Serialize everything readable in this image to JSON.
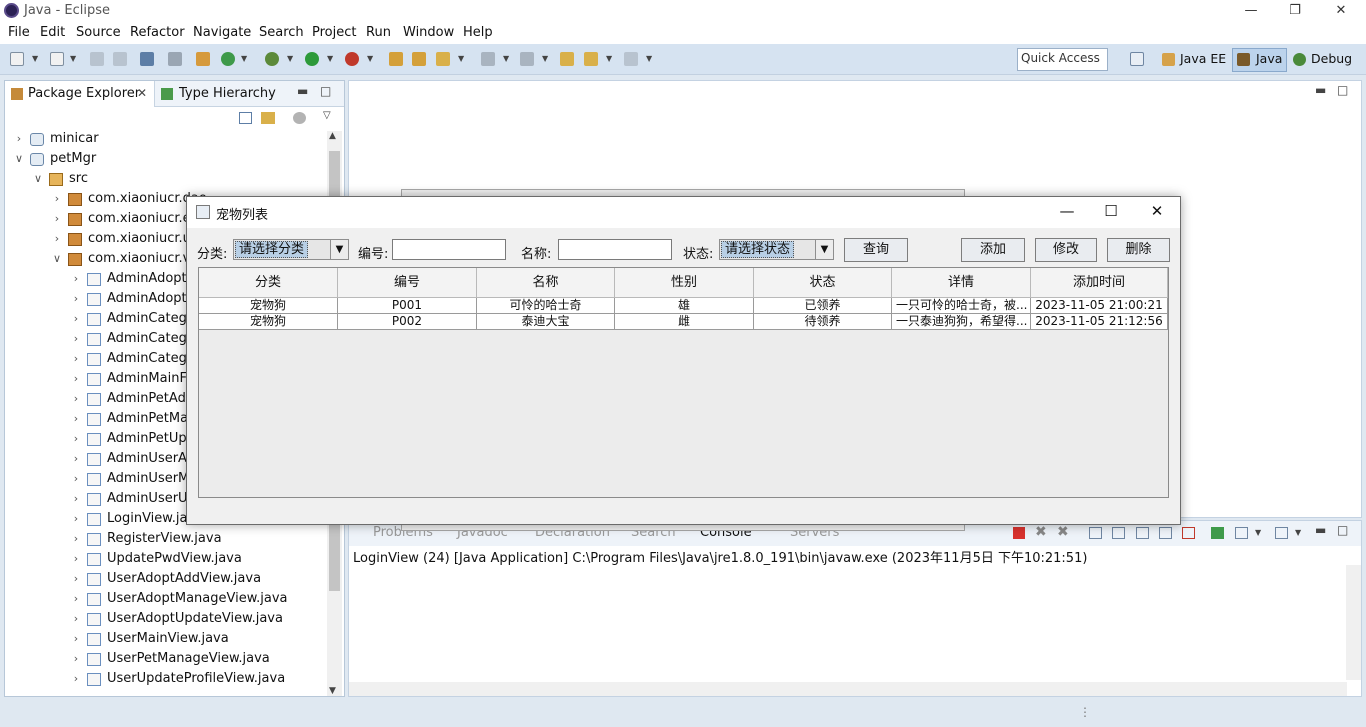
{
  "window": {
    "title": "Java - Eclipse"
  },
  "menu": [
    "File",
    "Edit",
    "Source",
    "Refactor",
    "Navigate",
    "Search",
    "Project",
    "Run",
    "Window",
    "Help"
  ],
  "toolbar": {
    "quick_access": "Quick Access",
    "perspectives": [
      "Java EE",
      "Java",
      "Debug"
    ],
    "active_perspective": "Java"
  },
  "explorer": {
    "tabs": [
      "Package Explorer",
      "Type Hierarchy"
    ],
    "tree": [
      {
        "label": "minicar",
        "icon": "project-icon",
        "expanded": false
      },
      {
        "label": "petMgr",
        "icon": "project-icon",
        "expanded": true
      },
      {
        "label": "src",
        "icon": "source-folder-icon",
        "expanded": true
      },
      {
        "label": "com.xiaoniucr.dao",
        "icon": "package-icon",
        "expanded": false
      },
      {
        "label": "com.xiaoniucr.entity",
        "icon": "package-icon",
        "expanded": false
      },
      {
        "label": "com.xiaoniucr.util",
        "icon": "package-icon",
        "expanded": false
      },
      {
        "label": "com.xiaoniucr.view",
        "icon": "package-icon",
        "expanded": true
      },
      {
        "label": "AdminAdoptCheckView.java",
        "icon": "java-file-icon"
      },
      {
        "label": "AdminAdoptManageView.java",
        "icon": "java-file-icon"
      },
      {
        "label": "AdminCategoryAddView.java",
        "icon": "java-file-icon"
      },
      {
        "label": "AdminCategoryManageView.java",
        "icon": "java-file-icon"
      },
      {
        "label": "AdminCategoryUpdateView.java",
        "icon": "java-file-icon"
      },
      {
        "label": "AdminMainFrame.java",
        "icon": "java-file-icon"
      },
      {
        "label": "AdminPetAddView.java",
        "icon": "java-file-icon"
      },
      {
        "label": "AdminPetManageView.java",
        "icon": "java-file-icon"
      },
      {
        "label": "AdminPetUpdateView.java",
        "icon": "java-file-icon"
      },
      {
        "label": "AdminUserAddView.java",
        "icon": "java-file-icon"
      },
      {
        "label": "AdminUserManageView.java",
        "icon": "java-file-icon"
      },
      {
        "label": "AdminUserUpdateView.java",
        "icon": "java-file-icon"
      },
      {
        "label": "LoginView.java",
        "icon": "java-file-icon"
      },
      {
        "label": "RegisterView.java",
        "icon": "java-file-icon"
      },
      {
        "label": "UpdatePwdView.java",
        "icon": "java-file-icon"
      },
      {
        "label": "UserAdoptAddView.java",
        "icon": "java-file-icon"
      },
      {
        "label": "UserAdoptManageView.java",
        "icon": "java-file-icon"
      },
      {
        "label": "UserAdoptUpdateView.java",
        "icon": "java-file-icon"
      },
      {
        "label": "UserMainView.java",
        "icon": "java-file-icon"
      },
      {
        "label": "UserPetManageView.java",
        "icon": "java-file-icon"
      },
      {
        "label": "UserUpdateProfileView.java",
        "icon": "java-file-icon"
      }
    ]
  },
  "console": {
    "tabs": [
      "Problems",
      "Javadoc",
      "Declaration",
      "Search",
      "Console",
      "Servers"
    ],
    "active_tab": "Console",
    "launch_line": "LoginView (24) [Java Application] C:\\Program Files\\Java\\jre1.8.0_191\\bin\\javaw.exe (2023年11月5日 下午10:21:51)"
  },
  "dialog": {
    "title": "宠物列表",
    "filters": {
      "category_label": "分类:",
      "category_value": "请选择分类",
      "code_label": "编号:",
      "code_value": "",
      "name_label": "名称:",
      "name_value": "",
      "status_label": "状态:",
      "status_value": "请选择状态"
    },
    "buttons": {
      "query": "查询",
      "add": "添加",
      "edit": "修改",
      "delete": "删除"
    },
    "columns": [
      "分类",
      "编号",
      "名称",
      "性别",
      "状态",
      "详情",
      "添加时间"
    ],
    "rows": [
      [
        "宠物狗",
        "P001",
        "可怜的哈士奇",
        "雄",
        "已领养",
        "一只可怜的哈士奇，被...",
        "2023-11-05 21:00:21"
      ],
      [
        "宠物狗",
        "P002",
        "泰迪大宝",
        "雌",
        "待领养",
        "一只泰迪狗狗，希望得...",
        "2023-11-05 21:12:56"
      ]
    ]
  }
}
